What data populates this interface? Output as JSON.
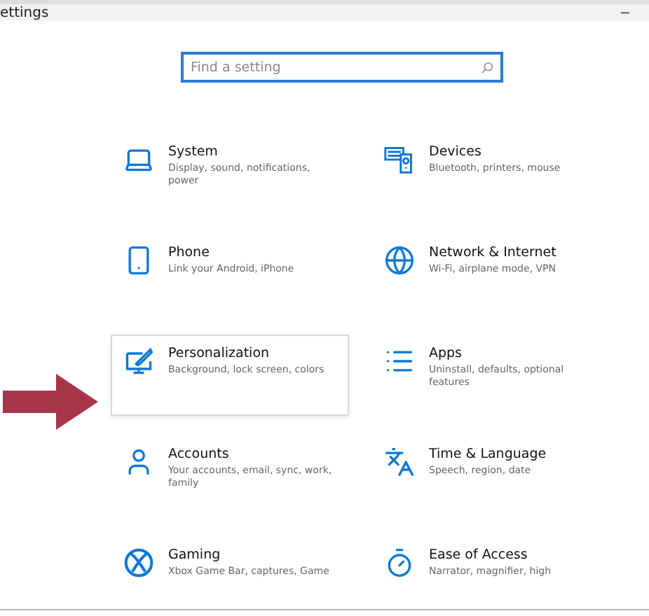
{
  "window": {
    "title": "ettings",
    "minimize": "–"
  },
  "search": {
    "placeholder": "Find a setting"
  },
  "tiles": [
    {
      "kind": "laptop",
      "title": "System",
      "subtitle": "Display, sound, notifications, power",
      "selected": false
    },
    {
      "kind": "devices",
      "title": "Devices",
      "subtitle": "Bluetooth, printers, mouse",
      "selected": false
    },
    {
      "kind": "phone",
      "title": "Phone",
      "subtitle": "Link your Android, iPhone",
      "selected": false
    },
    {
      "kind": "globe",
      "title": "Network & Internet",
      "subtitle": "Wi-Fi, airplane mode, VPN",
      "selected": false
    },
    {
      "kind": "brush",
      "title": "Personalization",
      "subtitle": "Background, lock screen, colors",
      "selected": true
    },
    {
      "kind": "list",
      "title": "Apps",
      "subtitle": "Uninstall, defaults, optional features",
      "selected": false
    },
    {
      "kind": "person",
      "title": "Accounts",
      "subtitle": "Your accounts, email, sync, work, family",
      "selected": false
    },
    {
      "kind": "language",
      "title": "Time & Language",
      "subtitle": "Speech, region, date",
      "selected": false
    },
    {
      "kind": "xbox",
      "title": "Gaming",
      "subtitle": "Xbox Game Bar, captures, Game",
      "selected": false
    },
    {
      "kind": "access",
      "title": "Ease of Access",
      "subtitle": "Narrator, magnifier, high",
      "selected": false
    }
  ]
}
